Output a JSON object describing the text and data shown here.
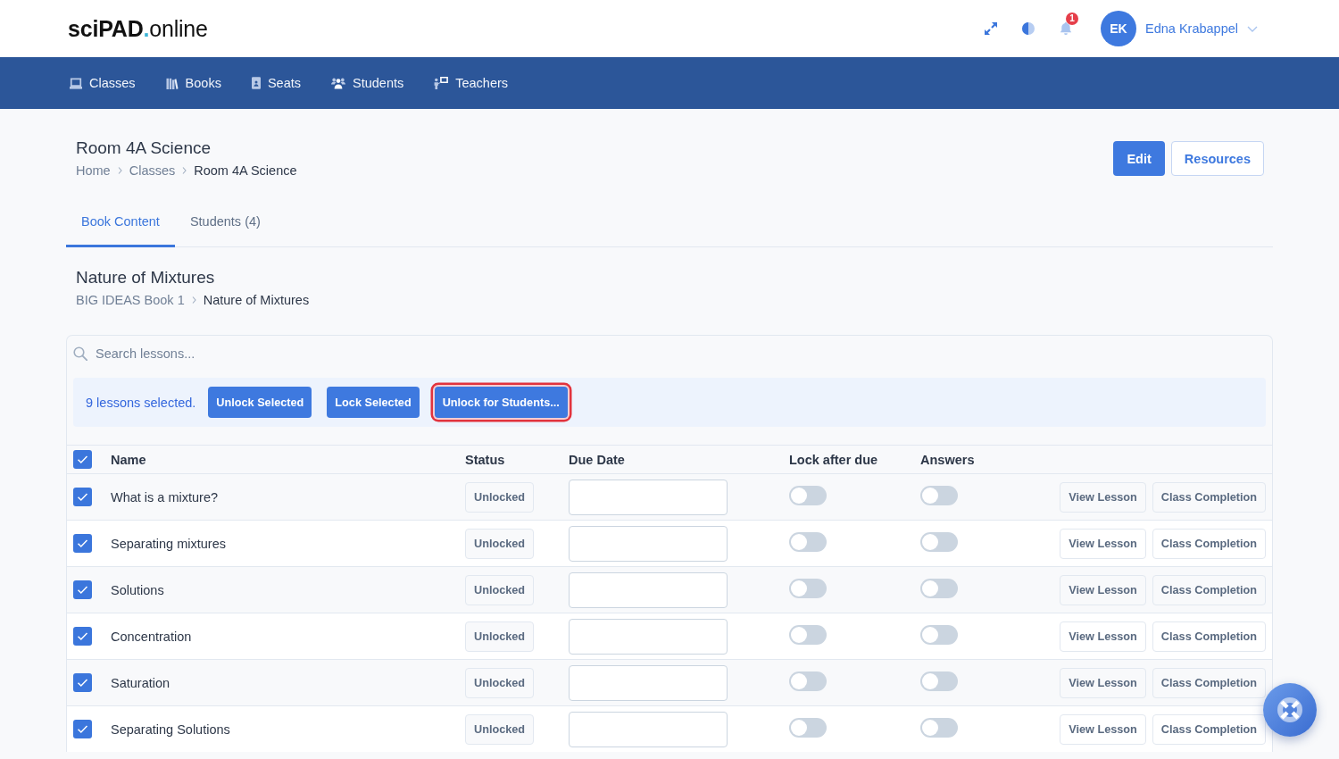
{
  "logo": {
    "strong": "sciPAD",
    "dot": ".",
    "rest": "online"
  },
  "header": {
    "notifications": {
      "count": "1"
    },
    "user": {
      "initials": "EK",
      "name": "Edna Krabappel"
    }
  },
  "nav": {
    "items": [
      {
        "label": "Classes"
      },
      {
        "label": "Books"
      },
      {
        "label": "Seats"
      },
      {
        "label": "Students"
      },
      {
        "label": "Teachers"
      }
    ]
  },
  "page": {
    "title": "Room 4A Science",
    "breadcrumb": [
      "Home",
      "Classes",
      "Room 4A Science"
    ],
    "actions": [
      {
        "label": "Edit",
        "kind": "primary"
      },
      {
        "label": "Resources",
        "kind": "outline"
      }
    ]
  },
  "tabs": [
    {
      "label": "Book Content",
      "selected": true
    },
    {
      "label": "Students (4)",
      "selected": false
    }
  ],
  "section": {
    "title": "Nature of Mixtures",
    "breadcrumb": [
      "BIG IDEAS Book 1",
      "Nature of Mixtures"
    ]
  },
  "search": {
    "placeholder": "Search lessons..."
  },
  "selection_bar": {
    "message": "9 lessons selected.",
    "buttons": [
      {
        "label": "Unlock Selected",
        "highlighted": false
      },
      {
        "label": "Lock Selected",
        "highlighted": false
      },
      {
        "label": "Unlock for Students...",
        "highlighted": true
      }
    ]
  },
  "table": {
    "select_all": {
      "checked": true
    },
    "columns": [
      "Name",
      "Status",
      "Due Date",
      "Lock after due",
      "Answers"
    ],
    "rows": [
      {
        "checked": true,
        "name": "What is a mixture?",
        "status": "Unlocked",
        "lock_after_due": {
          "on": false
        },
        "answers": {
          "on": false
        },
        "actions": [
          "View Lesson",
          "Class Completion"
        ]
      },
      {
        "checked": true,
        "name": "Separating mixtures",
        "status": "Unlocked",
        "lock_after_due": {
          "on": false
        },
        "answers": {
          "on": false
        },
        "actions": [
          "View Lesson",
          "Class Completion"
        ]
      },
      {
        "checked": true,
        "name": "Solutions",
        "status": "Unlocked",
        "lock_after_due": {
          "on": false
        },
        "answers": {
          "on": false
        },
        "actions": [
          "View Lesson",
          "Class Completion"
        ]
      },
      {
        "checked": true,
        "name": "Concentration",
        "status": "Unlocked",
        "lock_after_due": {
          "on": false
        },
        "answers": {
          "on": false
        },
        "actions": [
          "View Lesson",
          "Class Completion"
        ]
      },
      {
        "checked": true,
        "name": "Saturation",
        "status": "Unlocked",
        "lock_after_due": {
          "on": false
        },
        "answers": {
          "on": false
        },
        "actions": [
          "View Lesson",
          "Class Completion"
        ]
      },
      {
        "checked": true,
        "name": "Separating Solutions",
        "status": "Unlocked",
        "lock_after_due": {
          "on": false
        },
        "answers": {
          "on": false
        },
        "actions": [
          "View Lesson",
          "Class Completion"
        ]
      }
    ]
  }
}
